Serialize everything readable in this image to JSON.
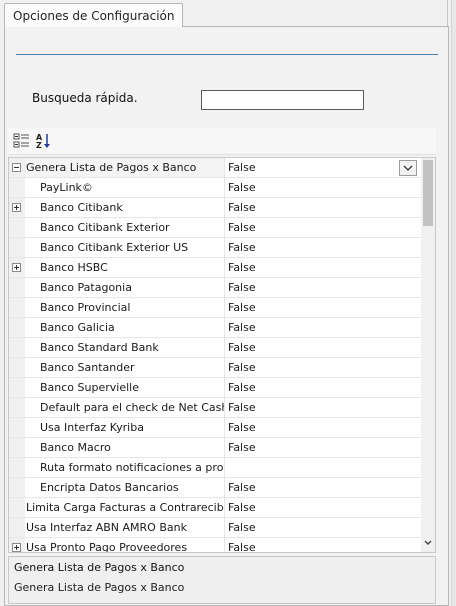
{
  "tab": {
    "label": "Opciones de Configuración"
  },
  "quick_search": {
    "label": "Busqueda rápida.",
    "value": ""
  },
  "toolbar": {
    "categorized_icon": "categorized-view-icon",
    "alphabetical_icon": "sort-az-icon"
  },
  "grid": {
    "rows": [
      {
        "name": "Genera Lista de Pagos x Banco",
        "value": "False",
        "level": 0,
        "expander": "minus",
        "selected": true
      },
      {
        "name": "PayLink©",
        "value": "False",
        "level": 1,
        "expander": ""
      },
      {
        "name": "Banco Citibank",
        "value": "False",
        "level": 1,
        "expander": "plus"
      },
      {
        "name": "Banco Citibank Exterior",
        "value": "False",
        "level": 1,
        "expander": ""
      },
      {
        "name": "Banco Citibank Exterior US",
        "value": "False",
        "level": 1,
        "expander": ""
      },
      {
        "name": "Banco HSBC",
        "value": "False",
        "level": 1,
        "expander": "plus"
      },
      {
        "name": "Banco Patagonia",
        "value": "False",
        "level": 1,
        "expander": ""
      },
      {
        "name": "Banco Provincial",
        "value": "False",
        "level": 1,
        "expander": ""
      },
      {
        "name": "Banco Galicia",
        "value": "False",
        "level": 1,
        "expander": ""
      },
      {
        "name": "Banco Standard Bank",
        "value": "False",
        "level": 1,
        "expander": ""
      },
      {
        "name": "Banco Santander",
        "value": "False",
        "level": 1,
        "expander": ""
      },
      {
        "name": "Banco Supervielle",
        "value": "False",
        "level": 1,
        "expander": ""
      },
      {
        "name": "Default para el check de Net Cash",
        "value": "False",
        "level": 1,
        "expander": ""
      },
      {
        "name": "Usa Interfaz Kyriba",
        "value": "False",
        "level": 1,
        "expander": ""
      },
      {
        "name": "Banco Macro",
        "value": "False",
        "level": 1,
        "expander": ""
      },
      {
        "name": "Ruta formato notificaciones a prov.",
        "value": "",
        "level": 1,
        "expander": ""
      },
      {
        "name": "Encripta Datos Bancarios",
        "value": "False",
        "level": 1,
        "expander": ""
      },
      {
        "name": "Limita Carga Facturas a Contrarecibos",
        "value": "False",
        "level": 0,
        "expander": ""
      },
      {
        "name": "Usa Interfaz ABN AMRO Bank",
        "value": "False",
        "level": 0,
        "expander": ""
      },
      {
        "name": "Usa Pronto Pago Proveedores",
        "value": "False",
        "level": 0,
        "expander": "plus"
      }
    ]
  },
  "help": {
    "title": "Genera Lista de Pagos x Banco",
    "description": "Genera Lista de Pagos x Banco"
  }
}
